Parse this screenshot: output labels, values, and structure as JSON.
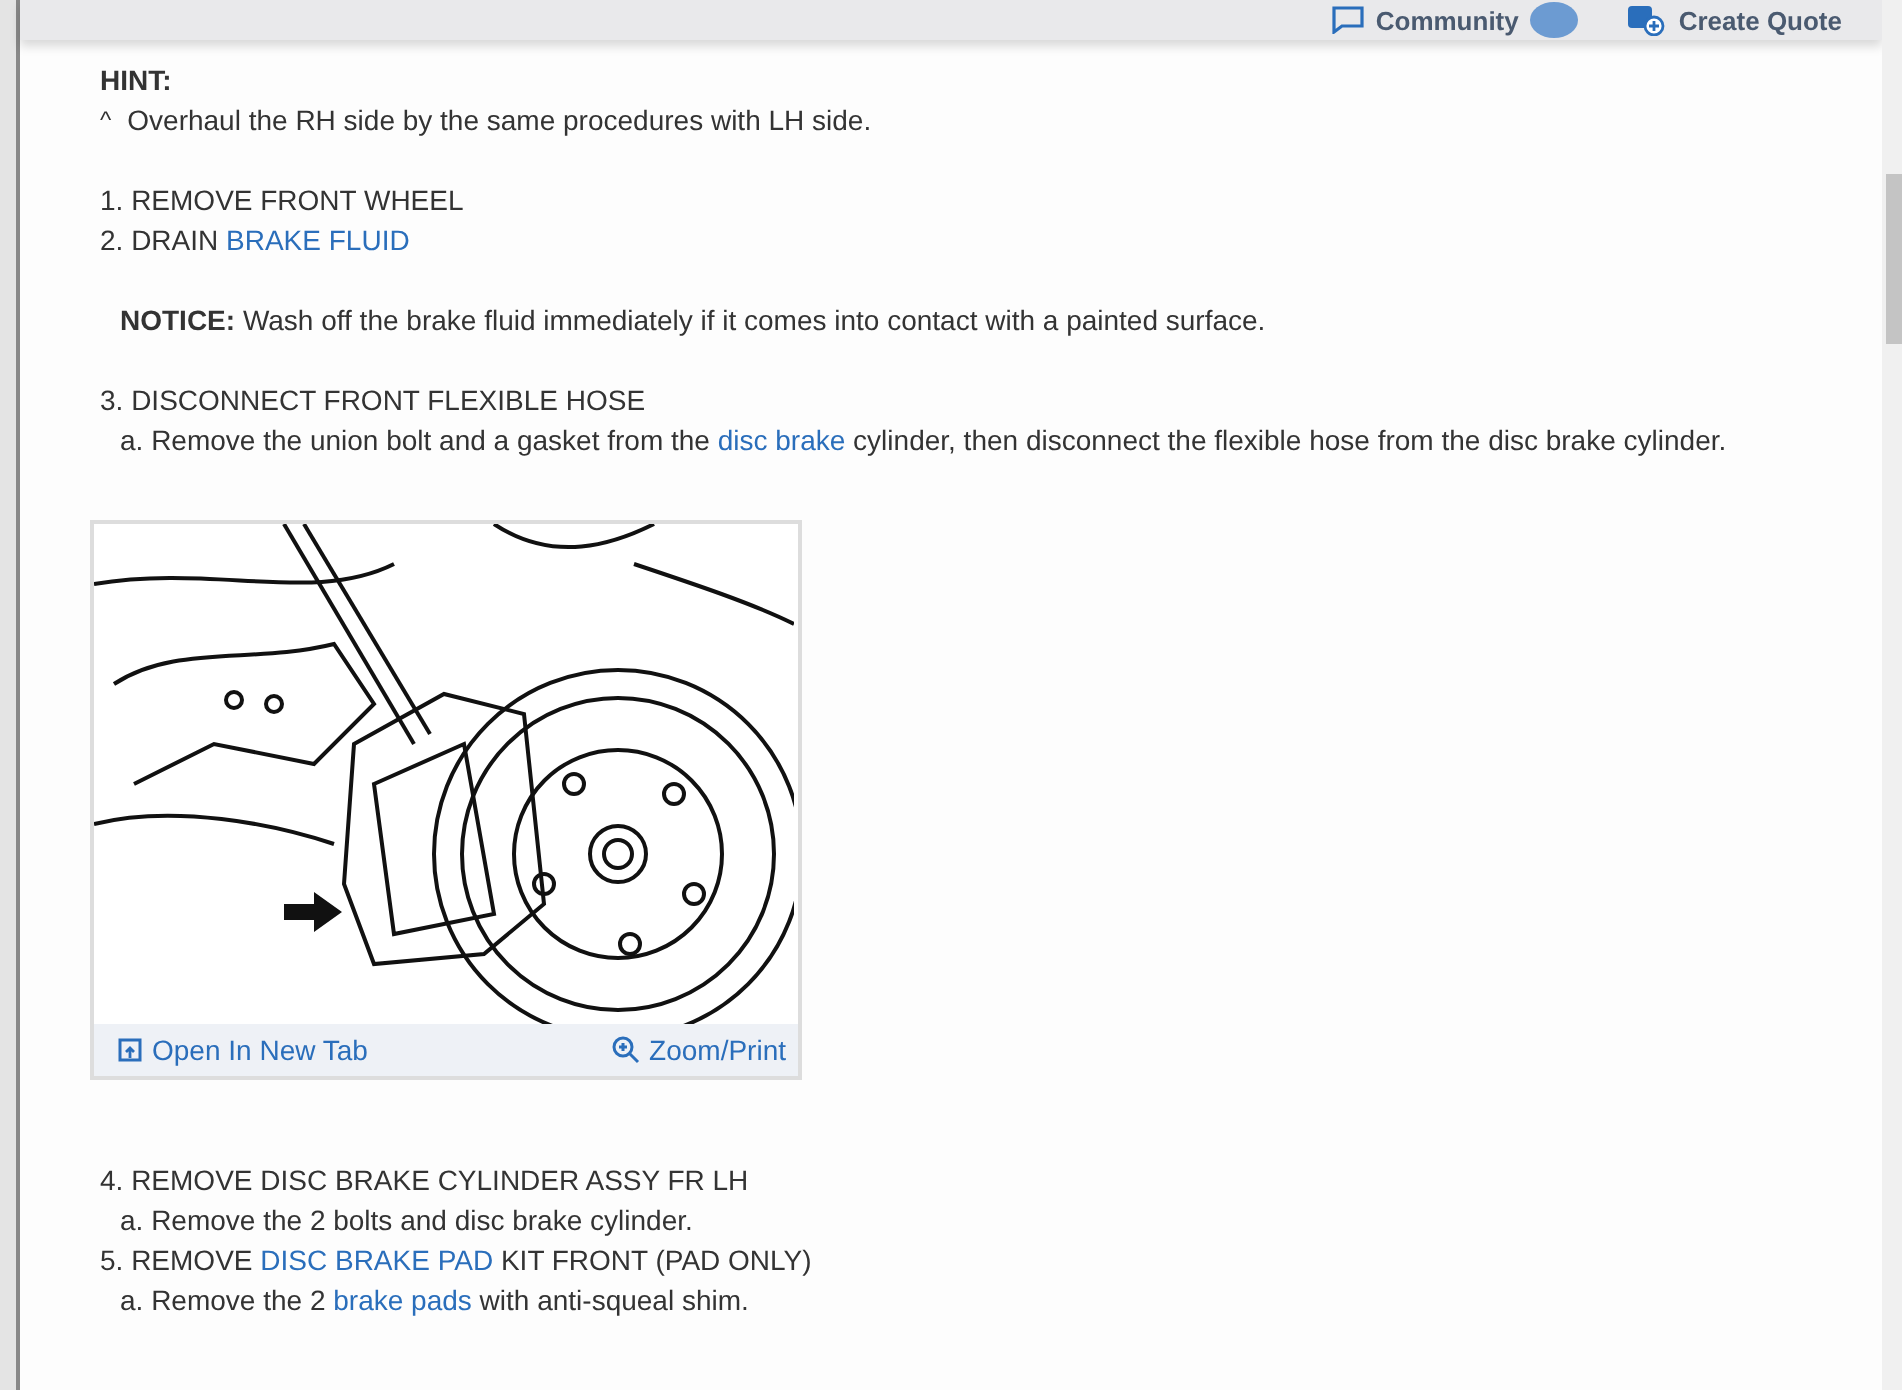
{
  "header": {
    "community_label": "Community",
    "quote_label": "Create Quote"
  },
  "hint": {
    "label": "HINT:",
    "marker": "^",
    "text": "Overhaul the RH side by the same procedures with LH side."
  },
  "items": [
    {
      "kind": "step",
      "parts": [
        {
          "text": "1. REMOVE FRONT WHEEL",
          "link": false
        }
      ]
    },
    {
      "kind": "step",
      "parts": [
        {
          "text": "2. DRAIN ",
          "link": false
        },
        {
          "text": "BRAKE FLUID",
          "link": true
        }
      ]
    },
    {
      "kind": "notice",
      "label": "NOTICE:",
      "text": "Wash off the brake fluid immediately if it comes into contact with a painted surface."
    },
    {
      "kind": "step",
      "parts": [
        {
          "text": "3. DISCONNECT FRONT FLEXIBLE HOSE",
          "link": false
        }
      ]
    },
    {
      "kind": "substep",
      "parts": [
        {
          "text": "a. Remove the union bolt and a gasket from the ",
          "link": false
        },
        {
          "text": "disc brake",
          "link": true
        },
        {
          "text": " cylinder, then disconnect the flexible hose from the disc brake cylinder.",
          "link": false
        }
      ]
    },
    {
      "kind": "figure",
      "open_label": "Open In New Tab",
      "zoom_label": "Zoom/Print"
    },
    {
      "kind": "step",
      "parts": [
        {
          "text": "4. REMOVE DISC BRAKE CYLINDER ASSY FR LH",
          "link": false
        }
      ]
    },
    {
      "kind": "substep",
      "parts": [
        {
          "text": "a. Remove the 2 bolts and disc brake cylinder.",
          "link": false
        }
      ]
    },
    {
      "kind": "step",
      "parts": [
        {
          "text": "5. REMOVE ",
          "link": false
        },
        {
          "text": "DISC BRAKE PAD",
          "link": true
        },
        {
          "text": " KIT FRONT (PAD ONLY)",
          "link": false
        }
      ]
    },
    {
      "kind": "substep",
      "parts": [
        {
          "text": "a. Remove the 2 ",
          "link": false
        },
        {
          "text": "brake pads",
          "link": true
        },
        {
          "text": " with anti-squeal shim.",
          "link": false
        }
      ]
    }
  ]
}
